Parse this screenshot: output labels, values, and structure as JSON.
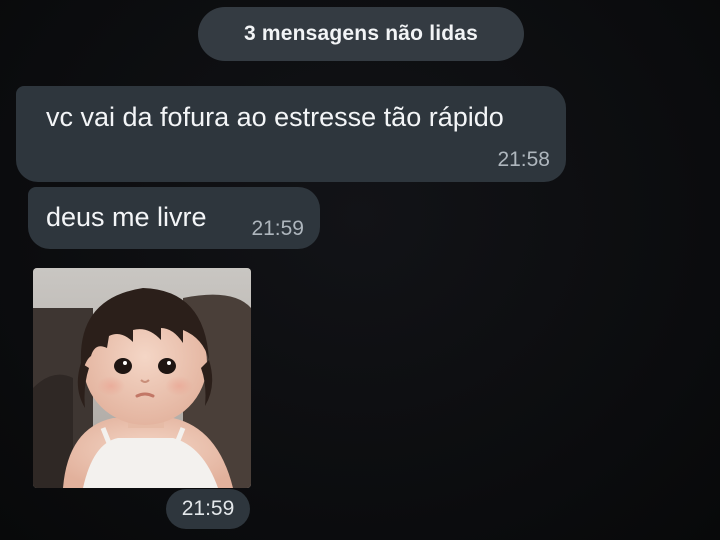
{
  "unread_banner": {
    "label": "3 mensagens não lidas"
  },
  "messages": [
    {
      "text": "vc vai da fofura ao estresse tão rápido",
      "time": "21:58"
    },
    {
      "text": "deus me livre",
      "time": "21:59"
    }
  ],
  "photo_message": {
    "time": "21:59"
  },
  "colors": {
    "background": "#0d0e10",
    "bubble": "#2e363d",
    "text": "#f3f5f7",
    "timestamp": "#aeb6bd"
  }
}
